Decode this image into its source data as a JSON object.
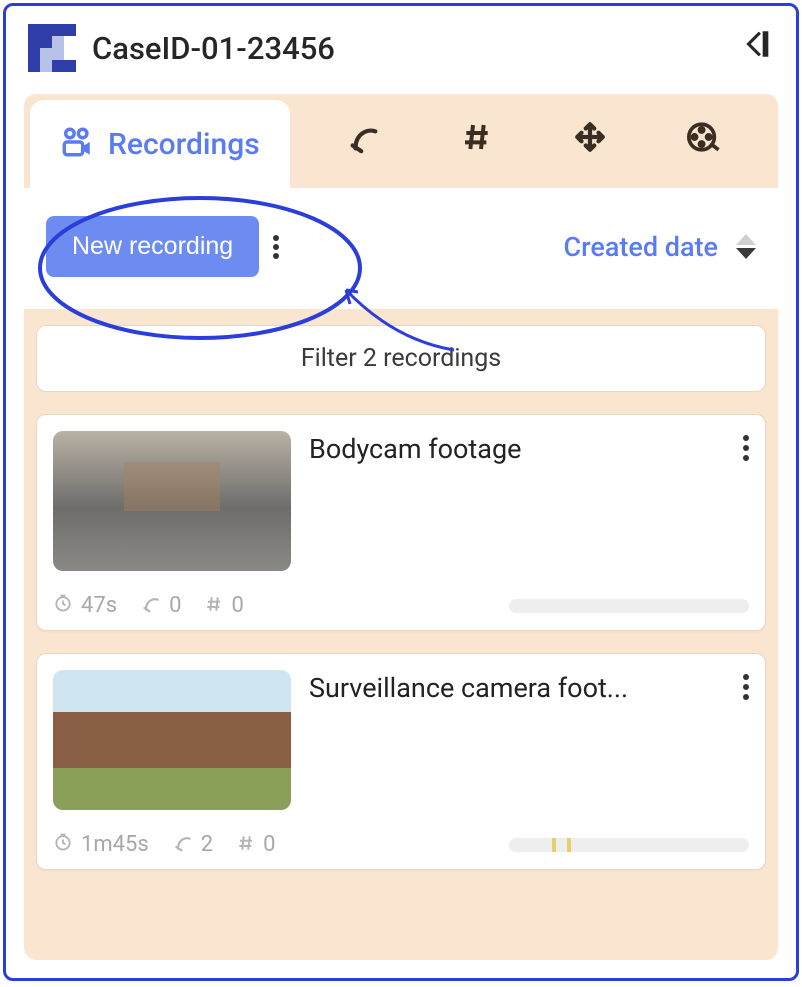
{
  "header": {
    "title": "CaseID-01-23456"
  },
  "tabs": {
    "active_label": "Recordings"
  },
  "toolbar": {
    "new_recording_label": "New recording",
    "sort_label": "Created date"
  },
  "filter": {
    "text": "Filter 2 recordings"
  },
  "recordings": [
    {
      "title": "Bodycam footage",
      "duration": "47s",
      "mark_count": "0",
      "hash_count": "0",
      "thumb_class": "street",
      "progress_marks": []
    },
    {
      "title": "Surveillance camera foot...",
      "duration": "1m45s",
      "mark_count": "2",
      "hash_count": "0",
      "thumb_class": "house",
      "progress_marks": [
        18,
        24
      ]
    }
  ]
}
